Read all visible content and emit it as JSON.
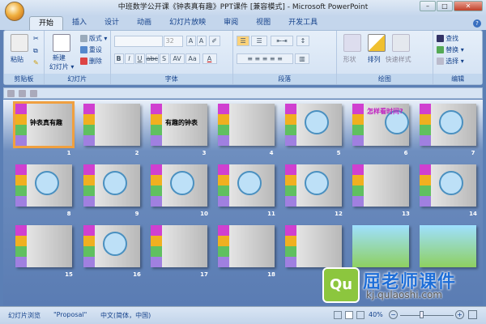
{
  "window": {
    "title": "中班数学公开课《钟表真有趣》PPT课件 [兼容模式] - Microsoft PowerPoint",
    "minimize": "–",
    "maximize": "□",
    "close": "✕"
  },
  "tabs": [
    "开始",
    "插入",
    "设计",
    "动画",
    "幻灯片放映",
    "审阅",
    "视图",
    "开发工具"
  ],
  "ribbon": {
    "clipboard": {
      "label": "剪贴板",
      "paste": "粘贴"
    },
    "slides": {
      "label": "幻灯片",
      "new_slide": "新建",
      "new_slide2": "幻灯片 ▾",
      "layout": "版式 ▾",
      "reset": "重设",
      "delete": "删除"
    },
    "font": {
      "label": "字体",
      "font_name": "",
      "font_size": "32",
      "bold": "B",
      "italic": "I",
      "underline": "U",
      "strike": "abc",
      "shadow": "S",
      "spacing": "AV",
      "case": "Aa",
      "color": "A"
    },
    "paragraph": {
      "label": "段落"
    },
    "drawing": {
      "label": "绘图",
      "shapes": "形状",
      "arrange": "排列",
      "quick_styles": "快速样式"
    },
    "editing": {
      "label": "编辑",
      "find": "查找",
      "replace": "替换 ▾",
      "select": "选择 ▾"
    }
  },
  "slides": [
    {
      "n": "1",
      "title": "钟表真有趣",
      "kind": "title"
    },
    {
      "n": "2",
      "title": "",
      "kind": "text"
    },
    {
      "n": "3",
      "title": "有趣的钟表",
      "kind": "title"
    },
    {
      "n": "4",
      "title": "",
      "kind": "text"
    },
    {
      "n": "5",
      "title": "",
      "kind": "clock"
    },
    {
      "n": "6",
      "title": "怎样看时间?",
      "kind": "clock"
    },
    {
      "n": "7",
      "title": "",
      "kind": "clock"
    },
    {
      "n": "8",
      "title": "",
      "kind": "clock"
    },
    {
      "n": "9",
      "title": "",
      "kind": "clock"
    },
    {
      "n": "10",
      "title": "",
      "kind": "clock"
    },
    {
      "n": "11",
      "title": "",
      "kind": "clock"
    },
    {
      "n": "12",
      "title": "",
      "kind": "clock"
    },
    {
      "n": "13",
      "title": "",
      "kind": "text"
    },
    {
      "n": "14",
      "title": "",
      "kind": "clock"
    },
    {
      "n": "15",
      "title": "",
      "kind": "text"
    },
    {
      "n": "16",
      "title": "",
      "kind": "clock"
    },
    {
      "n": "17",
      "title": "",
      "kind": "text"
    },
    {
      "n": "18",
      "title": "",
      "kind": "text"
    },
    {
      "n": "19",
      "title": "",
      "kind": "end"
    },
    {
      "n": "",
      "title": "",
      "kind": "green"
    },
    {
      "n": "",
      "title": "",
      "kind": "green"
    }
  ],
  "status": {
    "view": "幻灯片浏览",
    "theme": "\"Proposal\"",
    "language": "中文(简体，中国)",
    "zoom": "40%",
    "zoom_percent": 40
  },
  "watermark": {
    "brand": "屈老师课件",
    "url": "kj.qulaoshi.com",
    "logo": "Qu"
  }
}
